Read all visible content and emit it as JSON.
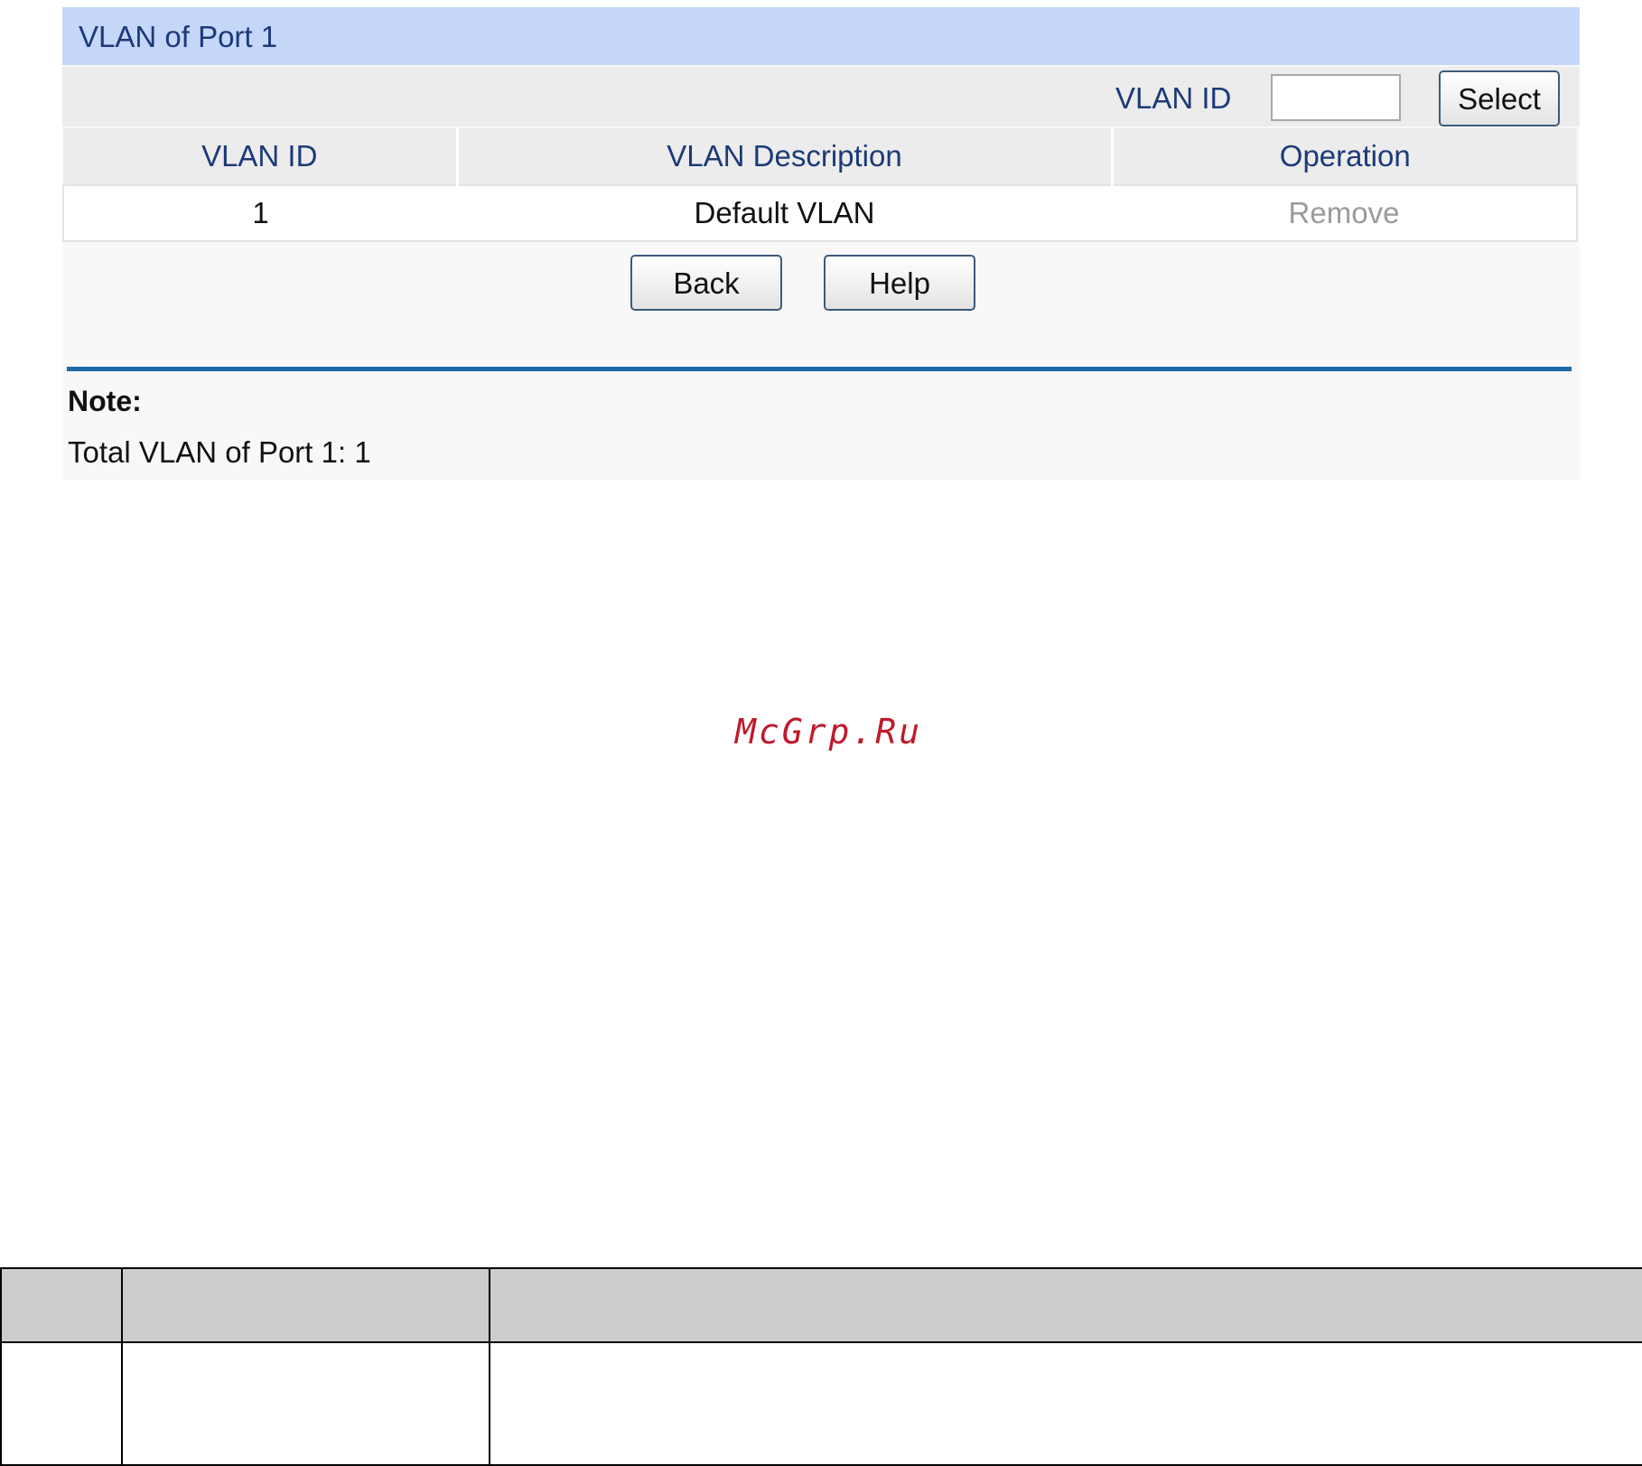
{
  "panel": {
    "title": "VLAN of Port 1",
    "filter_label": "VLAN ID",
    "filter_value": "",
    "select_label": "Select"
  },
  "table": {
    "columns": [
      "VLAN ID",
      "VLAN Description",
      "Operation"
    ],
    "rows": [
      {
        "vlan_id": "1",
        "description": "Default VLAN",
        "operation": "Remove"
      }
    ]
  },
  "actions": {
    "back_label": "Back",
    "help_label": "Help"
  },
  "note": {
    "title": "Note:",
    "text": "Total VLAN of Port 1: 1"
  },
  "watermark": "McGrp.Ru",
  "colors": {
    "title_bar": "#c5d7f8",
    "header_text": "#1c3a78",
    "divider": "#1f6aa5",
    "disabled_text": "#9a9a9a",
    "watermark": "#c0192b"
  }
}
